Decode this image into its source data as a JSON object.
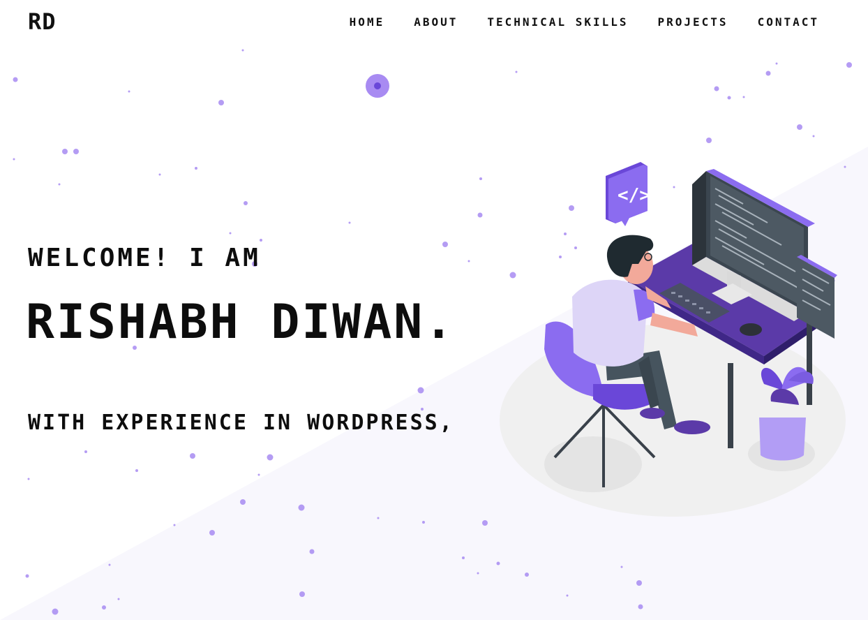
{
  "brand": {
    "logo": "RD"
  },
  "nav": {
    "items": [
      {
        "label": "HOME"
      },
      {
        "label": "ABOUT"
      },
      {
        "label": "TECHNICAL SKILLS"
      },
      {
        "label": "PROJECTS"
      },
      {
        "label": "CONTACT"
      }
    ]
  },
  "hero": {
    "greeting": "WELCOME! I AM",
    "name": "RISHABH DIWAN.",
    "tagline": "WITH EXPERIENCE IN WORDPRESS,"
  },
  "theme": {
    "accent": "#8b6cf0",
    "dark_accent": "#4b2d8f",
    "text": "#0d0d0d"
  },
  "illustration": {
    "icon": "developer-at-desk-icon",
    "badge_icon": "code-tag-icon"
  }
}
